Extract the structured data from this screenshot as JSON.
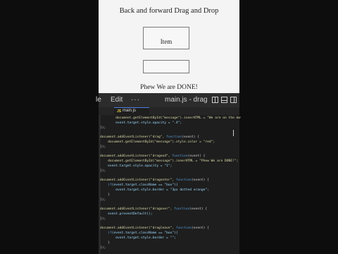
{
  "browser_page": {
    "title": "Back and forward Drag and Drop",
    "item_label": "Item",
    "message": "Phew We are DONE!"
  },
  "editor": {
    "menu": {
      "file": "le",
      "edit": "Edit",
      "more": "···"
    },
    "window_title": "main.js - drag-...",
    "tab": {
      "label": "main.js",
      "icon_text": "JS"
    },
    "code_lines": [
      [
        {
          "t": "        ",
          "c": "p"
        },
        {
          "t": "document.getElementById(\"message\").innerHTML = \"We are on the move\";",
          "c": "f"
        }
      ],
      [
        {
          "t": "        ",
          "c": "p"
        },
        {
          "t": "event.target.style.opacity = \".4\";",
          "c": "v"
        }
      ],
      [
        {
          "t": "});",
          "c": "p"
        }
      ],
      [
        {
          "t": "",
          "c": "p"
        }
      ],
      [
        {
          "t": "document.addEventListener(\"drag\", ",
          "c": "f"
        },
        {
          "t": "function",
          "c": "k"
        },
        {
          "t": "(event) {",
          "c": "p"
        }
      ],
      [
        {
          "t": "    ",
          "c": "p"
        },
        {
          "t": "document.getElementById(\"message\").style.color = \"red\";",
          "c": "f"
        }
      ],
      [
        {
          "t": "});",
          "c": "p"
        }
      ],
      [
        {
          "t": "",
          "c": "p"
        }
      ],
      [
        {
          "t": "document.addEventListener(\"dragend\", ",
          "c": "f"
        },
        {
          "t": "function",
          "c": "k"
        },
        {
          "t": "(event) {",
          "c": "p"
        }
      ],
      [
        {
          "t": "    ",
          "c": "p"
        },
        {
          "t": "document.getElementById(\"message\").innerHTML = \"Phew We are DONE!\";",
          "c": "f"
        }
      ],
      [
        {
          "t": "    ",
          "c": "p"
        },
        {
          "t": "event.target.style.opacity = \"1\";",
          "c": "v"
        }
      ],
      [
        {
          "t": "});",
          "c": "p"
        }
      ],
      [
        {
          "t": "",
          "c": "p"
        }
      ],
      [
        {
          "t": "document.addEventListener(\"dragenter\", ",
          "c": "f"
        },
        {
          "t": "function",
          "c": "k"
        },
        {
          "t": "(event) {",
          "c": "p"
        }
      ],
      [
        {
          "t": "    ",
          "c": "p"
        },
        {
          "t": "if",
          "c": "k"
        },
        {
          "t": "(event.target.className == \"box\"){",
          "c": "v"
        }
      ],
      [
        {
          "t": "        ",
          "c": "p"
        },
        {
          "t": "event.target.style.border = \"3px dotted orange\";",
          "c": "v"
        }
      ],
      [
        {
          "t": "    }",
          "c": "p"
        }
      ],
      [
        {
          "t": "});",
          "c": "p"
        }
      ],
      [
        {
          "t": "",
          "c": "p"
        }
      ],
      [
        {
          "t": "document.addEventListener(\"dragover\", ",
          "c": "f"
        },
        {
          "t": "function",
          "c": "k"
        },
        {
          "t": "(event) {",
          "c": "p"
        }
      ],
      [
        {
          "t": "    ",
          "c": "p"
        },
        {
          "t": "event.preventDefault();",
          "c": "v"
        }
      ],
      [
        {
          "t": "});",
          "c": "p"
        }
      ],
      [
        {
          "t": "",
          "c": "p"
        }
      ],
      [
        {
          "t": "document.addEventListener(\"dragleave\", ",
          "c": "f"
        },
        {
          "t": "function",
          "c": "k"
        },
        {
          "t": "(event) {",
          "c": "p"
        }
      ],
      [
        {
          "t": "    ",
          "c": "p"
        },
        {
          "t": "if",
          "c": "k"
        },
        {
          "t": "(event.target.className == \"box\"){",
          "c": "v"
        }
      ],
      [
        {
          "t": "        ",
          "c": "p"
        },
        {
          "t": "event.target.style.border = \"\";",
          "c": "v"
        }
      ],
      [
        {
          "t": "    }",
          "c": "p"
        }
      ],
      [
        {
          "t": "});",
          "c": "p"
        }
      ]
    ]
  },
  "colors": {
    "page_bg": "#f4f4f4",
    "editor_bg": "#1e1e1e",
    "titlebar_bg": "#2c2c2c",
    "keyword": "#569cd6",
    "function": "#dcdcaa",
    "string": "#ce9178",
    "variable": "#9cdcfe"
  }
}
